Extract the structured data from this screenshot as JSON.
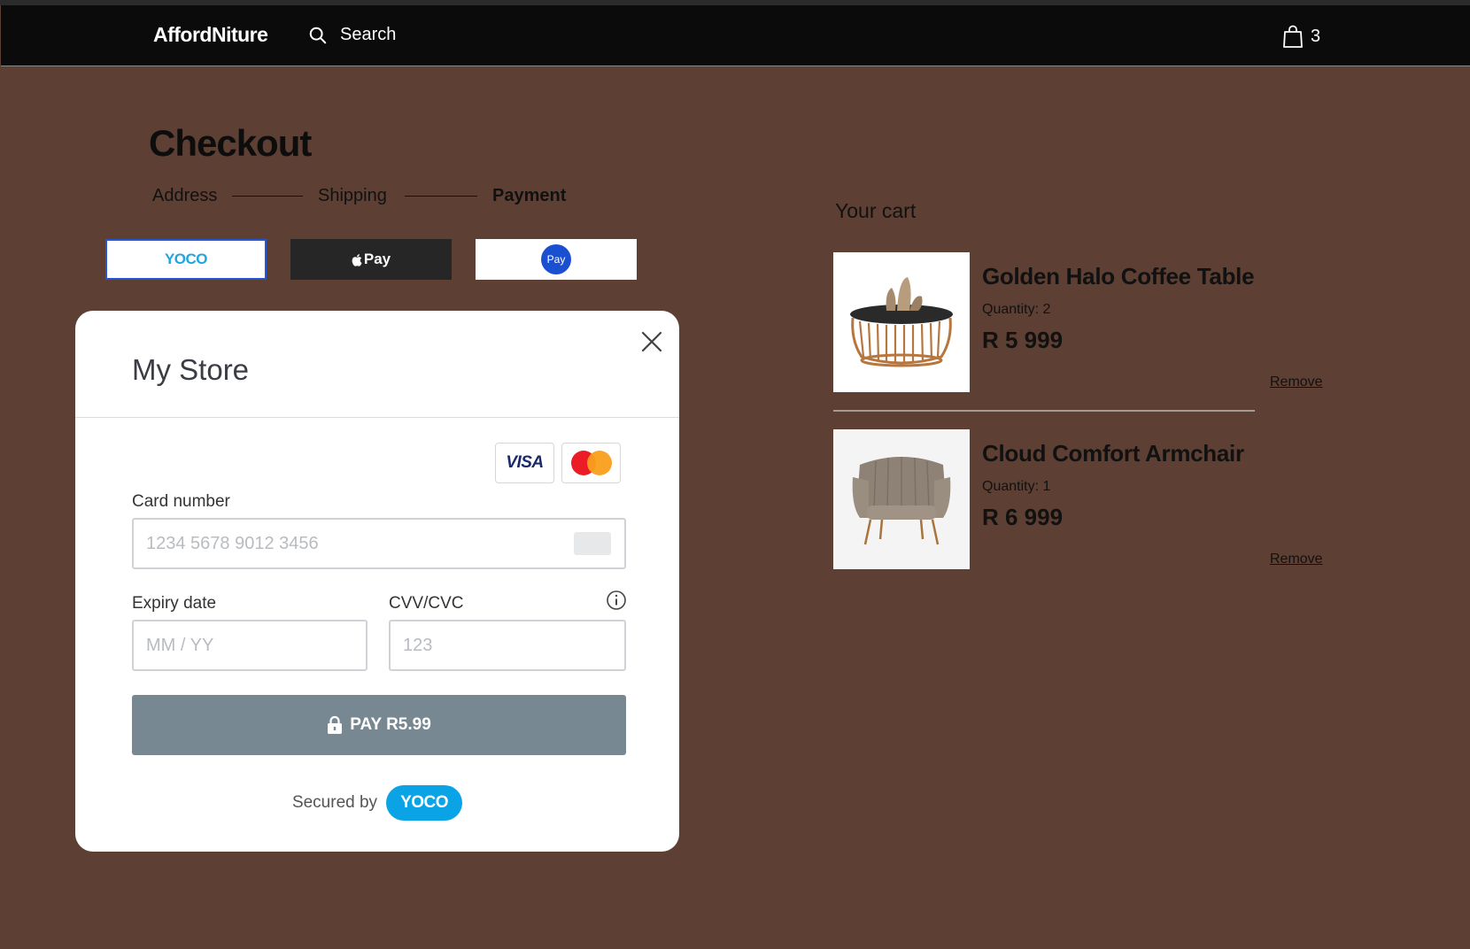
{
  "header": {
    "brand": "AffordNiture",
    "search_label": "Search",
    "cart_count": "3"
  },
  "checkout": {
    "title": "Checkout",
    "steps": [
      "Address",
      "Shipping",
      "Payment"
    ],
    "active_step": "Payment"
  },
  "payment_methods": {
    "yoco_label": "YOCO",
    "apple_label": "Pay",
    "samsung_label": "Pay"
  },
  "modal": {
    "title": "My Store",
    "card_number_label": "Card number",
    "card_number_placeholder": "1234 5678 9012 3456",
    "expiry_label": "Expiry date",
    "expiry_placeholder": "MM / YY",
    "cvv_label": "CVV/CVC",
    "cvv_placeholder": "123",
    "pay_button_label": "PAY R5.99",
    "secured_by_label": "Secured by",
    "secured_brand": "YOCO",
    "card_brands": [
      "VISA",
      "Mastercard"
    ]
  },
  "cart": {
    "title": "Your cart",
    "items": [
      {
        "name": "Golden Halo Coffee Table",
        "quantity": "Quantity: 2",
        "price": "R 5 999",
        "remove_label": "Remove"
      },
      {
        "name": "Cloud Comfort Armchair",
        "quantity": "Quantity: 1",
        "price": "R 6 999",
        "remove_label": "Remove"
      }
    ]
  },
  "colors": {
    "page_bg": "#5d3f33",
    "header_bg": "#0b0b0b",
    "yoco_blue": "#0aa4e6",
    "pay_button": "#778892",
    "samsung_blue": "#1a4fd1"
  }
}
